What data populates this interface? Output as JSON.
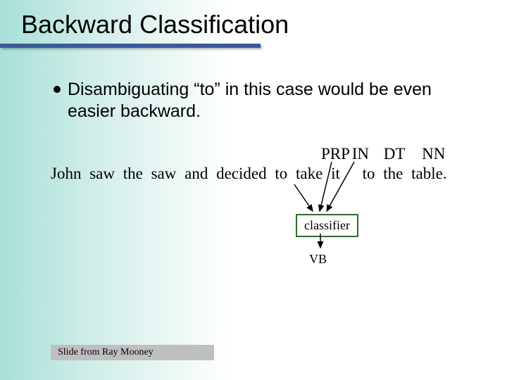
{
  "title": "Backward Classification",
  "bullet": "Disambiguating “to” in this case would be even easier backward.",
  "sentence": {
    "tokens": [
      "John",
      "saw",
      "the",
      "saw",
      "and",
      "decided",
      "to",
      "take",
      "it",
      "to",
      "the",
      "table."
    ]
  },
  "pos": {
    "prp": "PRP",
    "in": "IN",
    "dt": "DT",
    "nn": "NN"
  },
  "classifier_label": "classifier",
  "output_tag": "VB",
  "credit": "Slide from Ray Mooney"
}
